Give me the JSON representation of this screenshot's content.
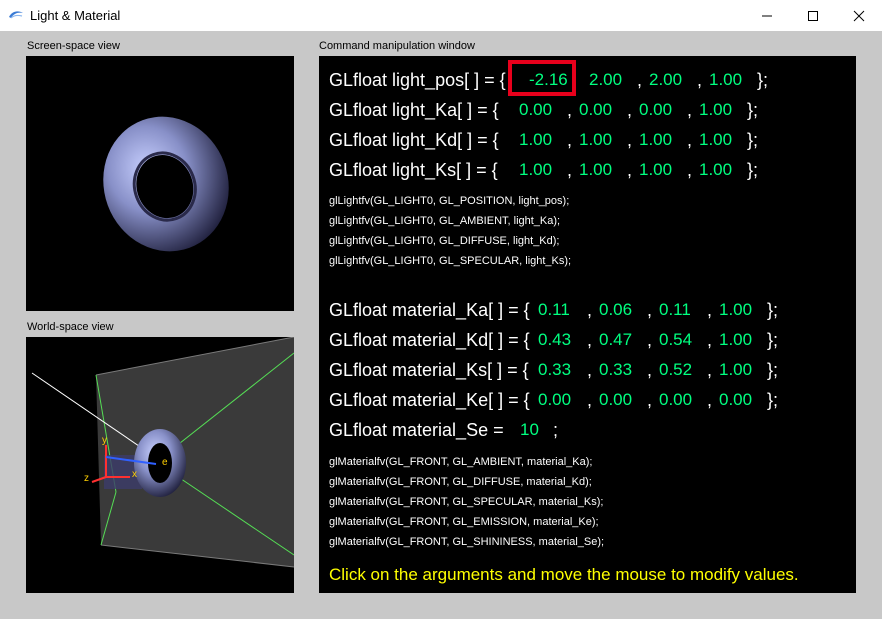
{
  "window": {
    "title": "Light & Material",
    "minimize": "—",
    "maximize": "☐",
    "close": "✕"
  },
  "screen_view": {
    "label": "Screen-space view"
  },
  "world_view": {
    "label": "World-space view",
    "axis_y": "y",
    "axis_z": "z",
    "axis_x": "x",
    "eye": "e"
  },
  "command": {
    "label": "Command manipulation window",
    "light_pos": {
      "decl": "GLfloat light_pos[ ] = {",
      "values": [
        "-2.16",
        "2.00",
        "2.00",
        "1.00"
      ],
      "end": "};"
    },
    "light_Ka": {
      "decl": "GLfloat light_Ka[ ] = {",
      "values": [
        "0.00",
        "0.00",
        "0.00",
        "1.00"
      ],
      "end": "};"
    },
    "light_Kd": {
      "decl": "GLfloat light_Kd[ ] = {",
      "values": [
        "1.00",
        "1.00",
        "1.00",
        "1.00"
      ],
      "end": "};"
    },
    "light_Ks": {
      "decl": "GLfloat light_Ks[ ] = {",
      "values": [
        "1.00",
        "1.00",
        "1.00",
        "1.00"
      ],
      "end": "};"
    },
    "light_calls": [
      "glLightfv(GL_LIGHT0, GL_POSITION, light_pos);",
      "glLightfv(GL_LIGHT0, GL_AMBIENT, light_Ka);",
      "glLightfv(GL_LIGHT0, GL_DIFFUSE, light_Kd);",
      "glLightfv(GL_LIGHT0, GL_SPECULAR, light_Ks);"
    ],
    "material_Ka": {
      "decl": "GLfloat material_Ka[ ] = {",
      "values": [
        "0.11",
        "0.06",
        "0.11",
        "1.00"
      ],
      "end": "};"
    },
    "material_Kd": {
      "decl": "GLfloat material_Kd[ ] = {",
      "values": [
        "0.43",
        "0.47",
        "0.54",
        "1.00"
      ],
      "end": "};"
    },
    "material_Ks": {
      "decl": "GLfloat material_Ks[ ] = {",
      "values": [
        "0.33",
        "0.33",
        "0.52",
        "1.00"
      ],
      "end": "};"
    },
    "material_Ke": {
      "decl": "GLfloat material_Ke[ ] = {",
      "values": [
        "0.00",
        "0.00",
        "0.00",
        "0.00"
      ],
      "end": "};"
    },
    "material_Se": {
      "decl": "GLfloat material_Se =",
      "value": "10",
      "end": ";"
    },
    "material_calls": [
      "glMaterialfv(GL_FRONT, GL_AMBIENT, material_Ka);",
      "glMaterialfv(GL_FRONT, GL_DIFFUSE, material_Kd);",
      "glMaterialfv(GL_FRONT, GL_SPECULAR, material_Ks);",
      "glMaterialfv(GL_FRONT, GL_EMISSION, material_Ke);",
      "glMaterialfv(GL_FRONT, GL_SHININESS, material_Se);"
    ],
    "hint": "Click on the arguments and move the mouse to modify values."
  },
  "colors": {
    "value": "#00ff80",
    "hint": "#ffff00",
    "highlight": "#e8001c",
    "panel": "#c8c8c8"
  }
}
